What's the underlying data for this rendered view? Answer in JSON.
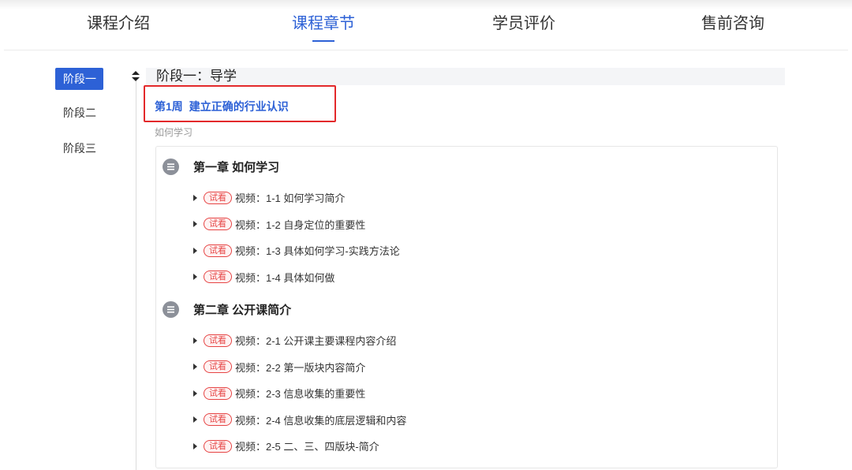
{
  "colors": {
    "accent": "#2d61d6",
    "text": "#333333",
    "highlight_box": "#e3292b",
    "trial_badge": "#e64545"
  },
  "icons": {
    "stage_toggle": "sort-icon",
    "chapter": "list-icon",
    "lesson_expand": "caret-right-icon"
  },
  "tabs": [
    {
      "label": "课程介绍",
      "active": false
    },
    {
      "label": "课程章节",
      "active": true
    },
    {
      "label": "学员评价",
      "active": false
    },
    {
      "label": "售前咨询",
      "active": false
    }
  ],
  "stages": [
    {
      "label": "阶段一",
      "active": true
    },
    {
      "label": "阶段二",
      "active": false
    },
    {
      "label": "阶段三",
      "active": false
    }
  ],
  "current_stage": {
    "title": "阶段一：导学",
    "week": {
      "number": "第1周",
      "title": "建立正确的行业认识",
      "subtitle": "如何学习"
    },
    "chapters": [
      {
        "title": "第一章 如何学习",
        "lessons": [
          {
            "badge": "试看",
            "label": "视频：1-1 如何学习简介"
          },
          {
            "badge": "试看",
            "label": "视频：1-2 自身定位的重要性"
          },
          {
            "badge": "试看",
            "label": "视频：1-3 具体如何学习-实践方法论"
          },
          {
            "badge": "试看",
            "label": "视频：1-4 具体如何做"
          }
        ]
      },
      {
        "title": "第二章 公开课简介",
        "lessons": [
          {
            "badge": "试看",
            "label": "视频：2-1 公开课主要课程内容介绍"
          },
          {
            "badge": "试看",
            "label": "视频：2-2 第一版块内容简介"
          },
          {
            "badge": "试看",
            "label": "视频：2-3 信息收集的重要性"
          },
          {
            "badge": "试看",
            "label": "视频：2-4 信息收集的底层逻辑和内容"
          },
          {
            "badge": "试看",
            "label": "视频：2-5 二、三、四版块-简介"
          }
        ]
      }
    ]
  }
}
